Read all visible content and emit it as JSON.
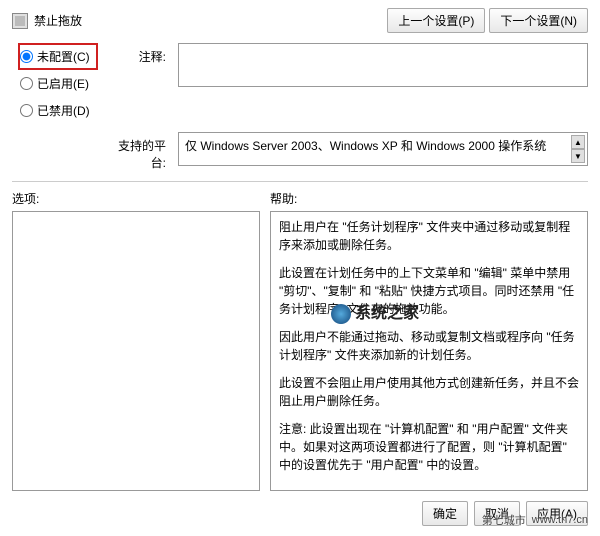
{
  "title": "禁止拖放",
  "nav": {
    "prev": "上一个设置(P)",
    "next": "下一个设置(N)"
  },
  "radios": {
    "not_configured": "未配置(C)",
    "enabled": "已启用(E)",
    "disabled": "已禁用(D)"
  },
  "labels": {
    "comment": "注释:",
    "platform": "支持的平台:",
    "options": "选项:",
    "help": "帮助:"
  },
  "platform_text": "仅 Windows Server 2003、Windows XP 和 Windows 2000 操作系统",
  "help_paragraphs": [
    "阻止用户在 \"任务计划程序\" 文件夹中通过移动或复制程序来添加或删除任务。",
    "此设置在计划任务中的上下文菜单和 \"编辑\" 菜单中禁用 \"剪切\"、\"复制\" 和 \"粘贴\" 快捷方式项目。同时还禁用 \"任务计划程序\" 文件夹的拖放功能。",
    "因此用户不能通过拖动、移动或复制文档或程序向 \"任务计划程序\" 文件夹添加新的计划任务。",
    "此设置不会阻止用户使用其他方式创建新任务，并且不会阻止用户删除任务。",
    "注意: 此设置出现在 \"计算机配置\" 和 \"用户配置\" 文件夹中。如果对这两项设置都进行了配置，则 \"计算机配置\" 中的设置优先于 \"用户配置\" 中的设置。"
  ],
  "buttons": {
    "ok": "确定",
    "cancel": "取消",
    "apply": "应用(A)"
  },
  "watermark": "系统之家",
  "footer": {
    "site": "第七城市",
    "url": "www.th7.cn"
  }
}
